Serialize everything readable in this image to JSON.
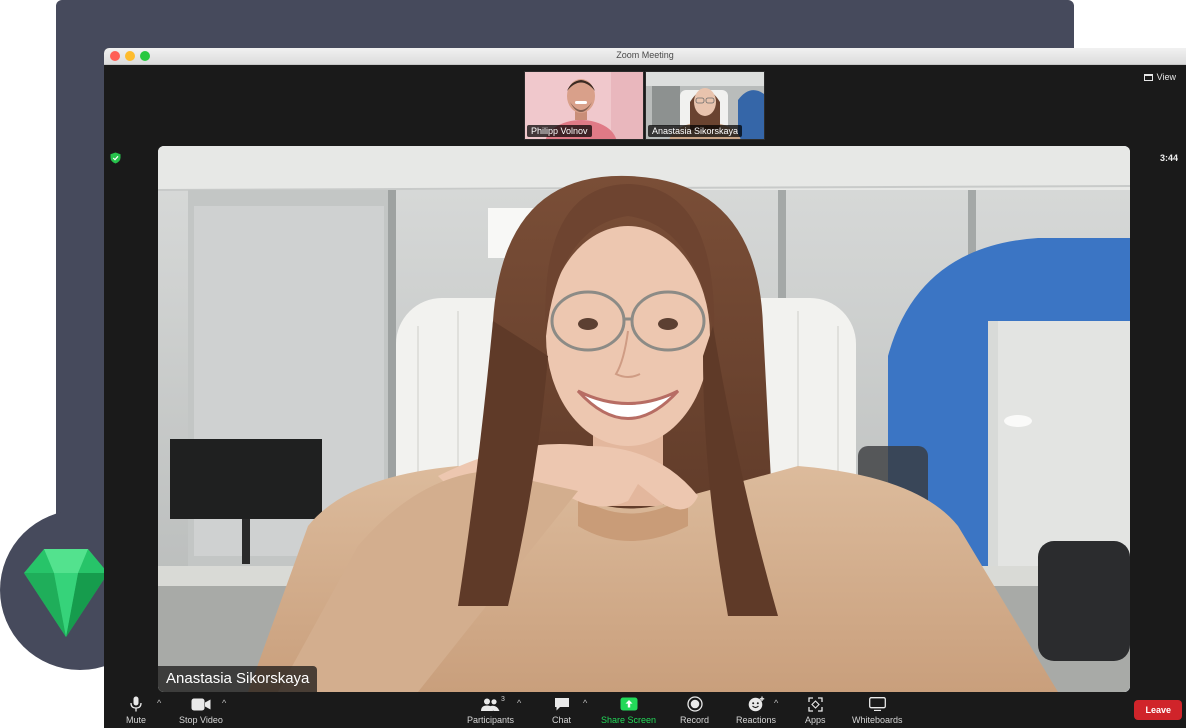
{
  "window": {
    "title": "Zoom Meeting"
  },
  "header": {
    "view_label": "View",
    "timer": "3:44",
    "thumbnails": [
      {
        "name": "Philipp Volnov"
      },
      {
        "name": "Anastasia Sikorskaya"
      }
    ]
  },
  "main_video": {
    "name": "Anastasia Sikorskaya"
  },
  "toolbar": {
    "participant_count": "3",
    "buttons": {
      "mute": "Mute",
      "stop_video": "Stop Video",
      "participants": "Participants",
      "chat": "Chat",
      "share_screen": "Share Screen",
      "record": "Record",
      "reactions": "Reactions",
      "apps": "Apps",
      "whiteboards": "Whiteboards"
    },
    "leave": "Leave"
  },
  "colors": {
    "leave": "#d0242a",
    "share_screen": "#23d959",
    "security_shield": "#27c24c",
    "backdrop": "#464a5c",
    "gem": "#2ecc71"
  },
  "icons": [
    "microphone-icon",
    "video-camera-icon",
    "participants-icon",
    "chat-icon",
    "share-screen-icon",
    "record-icon",
    "reactions-icon",
    "apps-icon",
    "whiteboards-icon",
    "shield-icon",
    "view-icon",
    "gem-icon"
  ]
}
